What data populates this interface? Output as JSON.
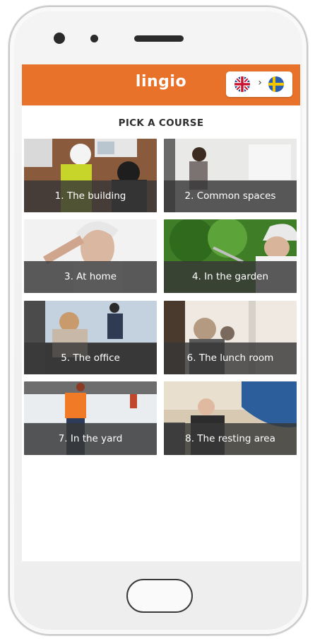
{
  "app": {
    "brand": "lingio"
  },
  "language": {
    "from": "uk-flag",
    "separator": "›",
    "to": "sweden-flag"
  },
  "page": {
    "title": "PICK A COURSE"
  },
  "colors": {
    "brand": "#e8722a",
    "label_overlay": "#373737"
  },
  "courses": [
    {
      "label": "1. The building"
    },
    {
      "label": "2. Common spaces"
    },
    {
      "label": "3. At home"
    },
    {
      "label": "4. In the garden"
    },
    {
      "label": "5. The office"
    },
    {
      "label": "6. The lunch room"
    },
    {
      "label": "7. In the yard"
    },
    {
      "label": "8. The resting area"
    }
  ]
}
